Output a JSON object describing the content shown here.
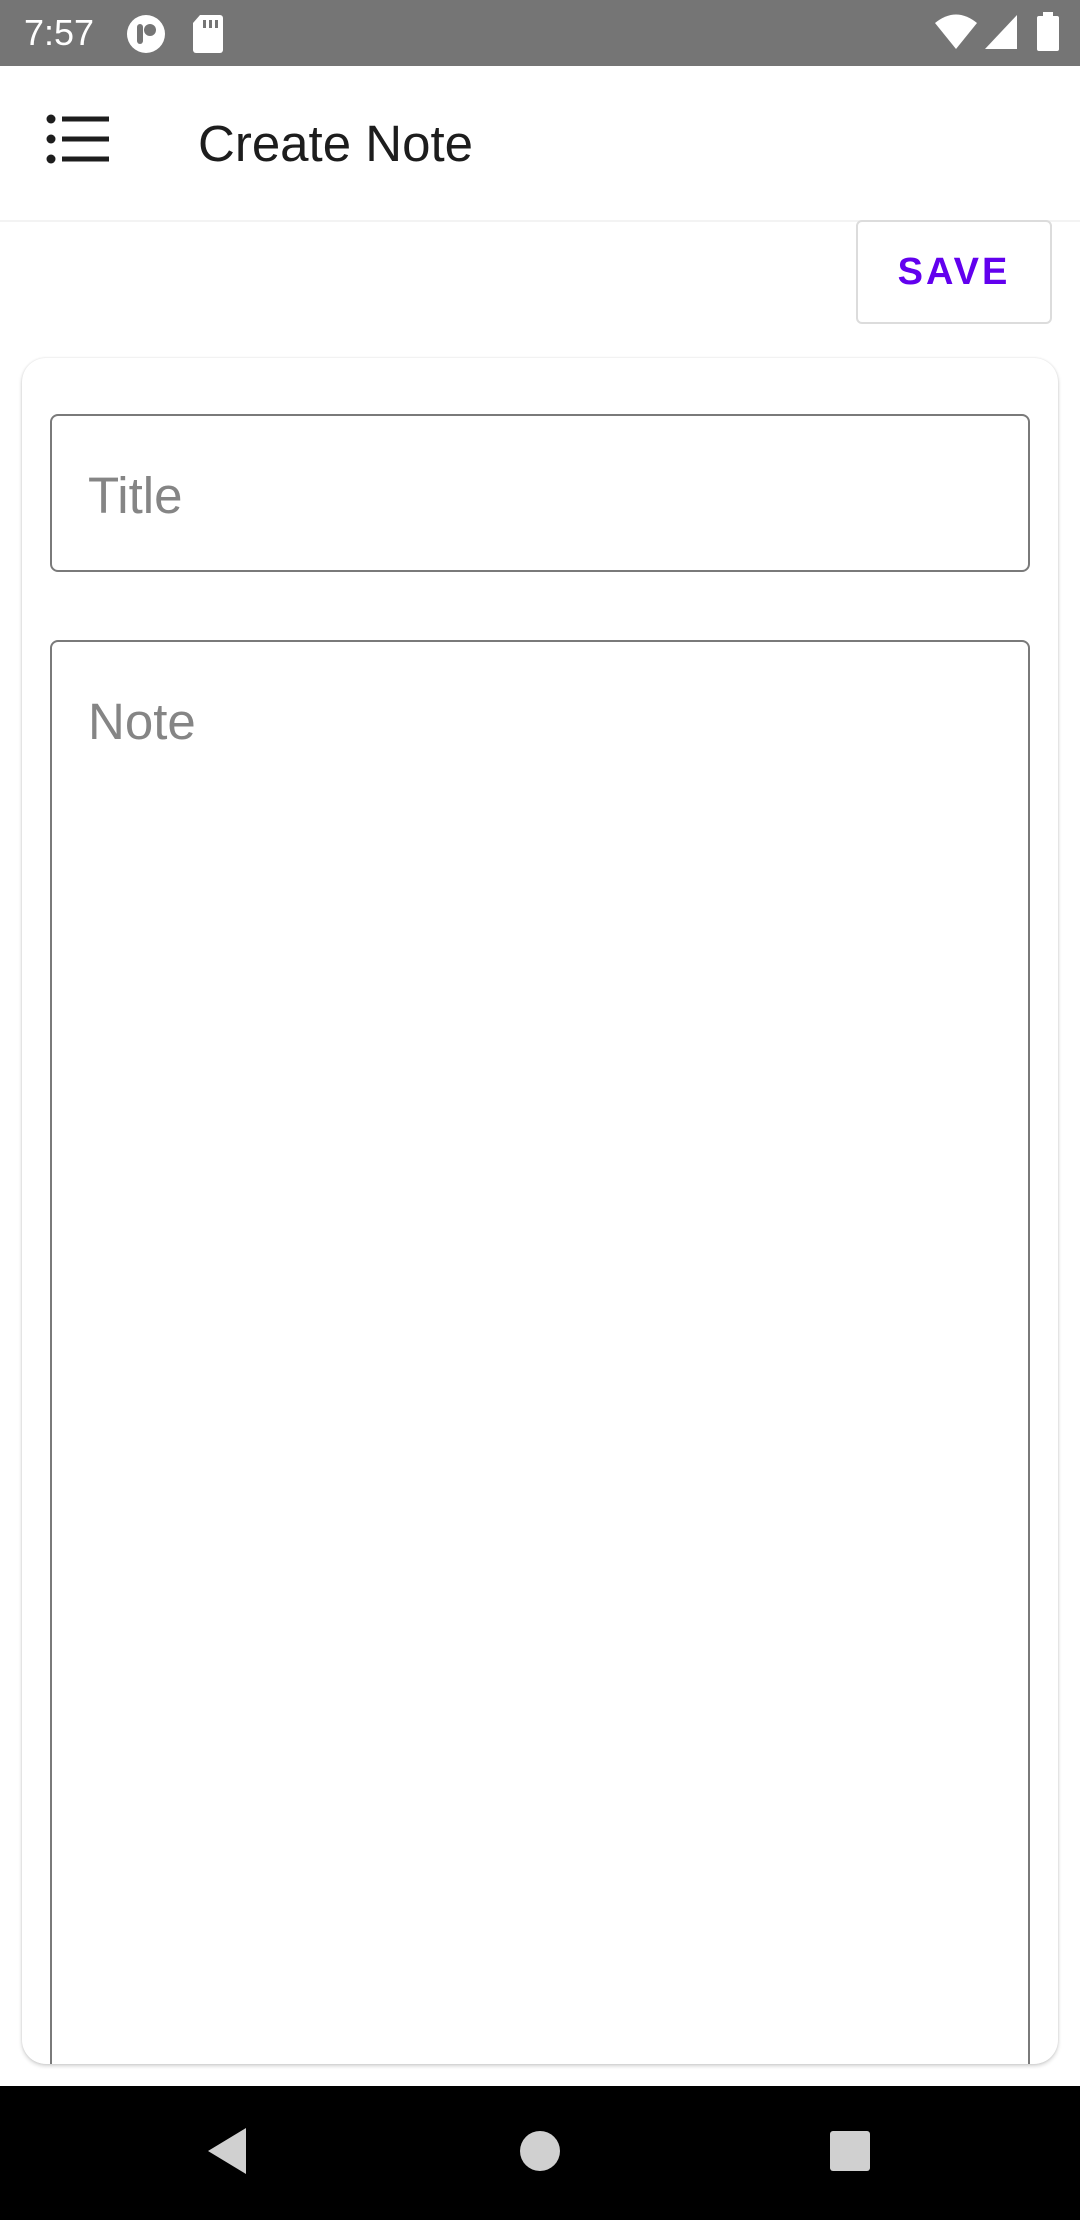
{
  "status_bar": {
    "time": "7:57",
    "left_icons": [
      "notification-app-icon",
      "sd-card-icon"
    ],
    "right_icons": [
      "wifi-icon",
      "cellular-signal-icon",
      "battery-icon"
    ],
    "background": "#757575"
  },
  "app_bar": {
    "menu_icon": "list-menu-icon",
    "title": "Create Note"
  },
  "toolbar": {
    "save_label": "SAVE",
    "accent_color": "#6200ee"
  },
  "form": {
    "title_placeholder": "Title",
    "title_value": "",
    "note_placeholder": "Note",
    "note_value": ""
  },
  "nav_bar": {
    "buttons": [
      "back-icon",
      "home-icon",
      "recents-icon"
    ]
  }
}
